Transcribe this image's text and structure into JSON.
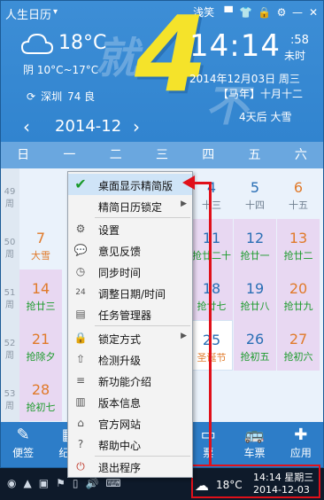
{
  "titlebar": {
    "app_name": "人生日历",
    "dropdown_caret": "▾",
    "theme_label": "浅笑",
    "icons": [
      "skin-icon",
      "shirt-icon",
      "lock-icon",
      "gear-icon",
      "minimize-icon",
      "close-icon"
    ],
    "icon_glyphs": [
      "▀",
      "👕",
      "🔒",
      "⚙",
      "—",
      "✕"
    ]
  },
  "brand": {
    "big_number": "4",
    "deco_left": "就",
    "deco_right": "不"
  },
  "weather": {
    "icon": "cloud-icon",
    "temp": "18°C",
    "range": "阴 10°C~17°C",
    "location": "深圳",
    "aqi": "74 良",
    "refresh_glyph": "⟳"
  },
  "clock": {
    "time": "14:14",
    "seconds": ":58",
    "seconds_label": "未时",
    "date": "2014年12月03日 周三",
    "lunar": "【马年】十月十二",
    "countdown": "4天后 大雪"
  },
  "nav": {
    "prev": "‹",
    "month": "2014-12",
    "next": "›"
  },
  "weekdays": [
    "日",
    "一",
    "二",
    "三",
    "四",
    "五",
    "六"
  ],
  "weeks": [
    {
      "num": "49",
      "label": "周"
    },
    {
      "num": "50",
      "label": "周"
    },
    {
      "num": "51",
      "label": "周"
    },
    {
      "num": "52",
      "label": "周"
    },
    {
      "num": "53",
      "label": "周"
    }
  ],
  "calendar": {
    "row0": [
      {
        "d": "4",
        "l": "十三",
        "c": "#2a6fb5"
      },
      {
        "d": "5",
        "l": "十四",
        "c": "#2a6fb5"
      },
      {
        "d": "6",
        "l": "十五",
        "c": "#e07a2a"
      }
    ],
    "row1_sun": {
      "d": "7",
      "l": "大雪",
      "c": "#e07a2a"
    },
    "row1": [
      {
        "d": "11",
        "l": "抢廿二十",
        "c": "#2a6fb5"
      },
      {
        "d": "12",
        "l": "抢廿一",
        "c": "#2a6fb5"
      },
      {
        "d": "13",
        "l": "抢廿二",
        "c": "#e07a2a"
      }
    ],
    "row2_sun": {
      "d": "14",
      "l": "抢廿三",
      "c": "#e07a2a"
    },
    "row2": [
      {
        "d": "18",
        "l": "抢廿七",
        "c": "#2a6fb5"
      },
      {
        "d": "19",
        "l": "抢廿八",
        "c": "#2a6fb5"
      },
      {
        "d": "20",
        "l": "抢廿九",
        "c": "#e07a2a"
      }
    ],
    "row3_sun": {
      "d": "21",
      "l": "抢除夕",
      "c": "#e07a2a"
    },
    "row3": [
      {
        "d": "25",
        "l": "圣诞节",
        "c": "#2a6fb5"
      },
      {
        "d": "26",
        "l": "抢初五",
        "c": "#2a6fb5"
      },
      {
        "d": "27",
        "l": "抢初六",
        "c": "#e07a2a"
      }
    ],
    "row4_sun": {
      "d": "28",
      "l": "抢初七",
      "c": "#e07a2a"
    }
  },
  "bottom_bar": [
    {
      "icon": "✎",
      "label": "便签"
    },
    {
      "icon": "▦",
      "label": "纪念"
    },
    {
      "icon": "",
      "label": ""
    },
    {
      "icon": "",
      "label": ""
    },
    {
      "icon": "▭",
      "label": "票"
    },
    {
      "icon": "🚌",
      "label": "车票"
    },
    {
      "icon": "✚",
      "label": "应用"
    }
  ],
  "menu": {
    "items": [
      {
        "label": "桌面显示精简版",
        "icon": "✔",
        "icon_name": "check-icon",
        "submenu": false,
        "active": true
      },
      {
        "label": "精简日历锁定",
        "icon": "",
        "icon_name": "none-icon",
        "submenu": true
      },
      {
        "label": "设置",
        "icon": "⚙",
        "icon_name": "gear-icon",
        "submenu": false
      },
      {
        "label": "意见反馈",
        "icon": "💬",
        "icon_name": "feedback-icon",
        "submenu": false
      },
      {
        "label": "同步时间",
        "icon": "◷",
        "icon_name": "clock-icon",
        "submenu": false
      },
      {
        "label": "调整日期/时间",
        "icon": "24",
        "icon_name": "calendar-icon",
        "submenu": false
      },
      {
        "label": "任务管理器",
        "icon": "▤",
        "icon_name": "task-manager-icon",
        "submenu": false
      },
      {
        "label": "锁定方式",
        "icon": "🔒",
        "icon_name": "lock-icon",
        "submenu": true
      },
      {
        "label": "检测升级",
        "icon": "⇧",
        "icon_name": "upgrade-icon",
        "submenu": false
      },
      {
        "label": "新功能介绍",
        "icon": "≡",
        "icon_name": "features-icon",
        "submenu": false
      },
      {
        "label": "版本信息",
        "icon": "▥",
        "icon_name": "version-icon",
        "submenu": false
      },
      {
        "label": "官方网站",
        "icon": "⌂",
        "icon_name": "home-icon",
        "submenu": false
      },
      {
        "label": "帮助中心",
        "icon": "?",
        "icon_name": "help-icon",
        "submenu": false
      },
      {
        "label": "退出程序",
        "icon": "⏻",
        "icon_name": "power-icon",
        "submenu": false
      }
    ],
    "submenu_glyph": "▶"
  },
  "taskbar": {
    "tray_glyphs": [
      "◉",
      "▲",
      "▣",
      "⚑",
      "▯",
      "🔊",
      "⌨"
    ],
    "weather_glyph": "☁",
    "temp": "18°C",
    "time": "14:14 星期三",
    "date": "2014-12-03"
  },
  "colors": {
    "accent": "#3184cf",
    "highlight_arrow": "#e0101a",
    "check": "#1a9a2a"
  }
}
